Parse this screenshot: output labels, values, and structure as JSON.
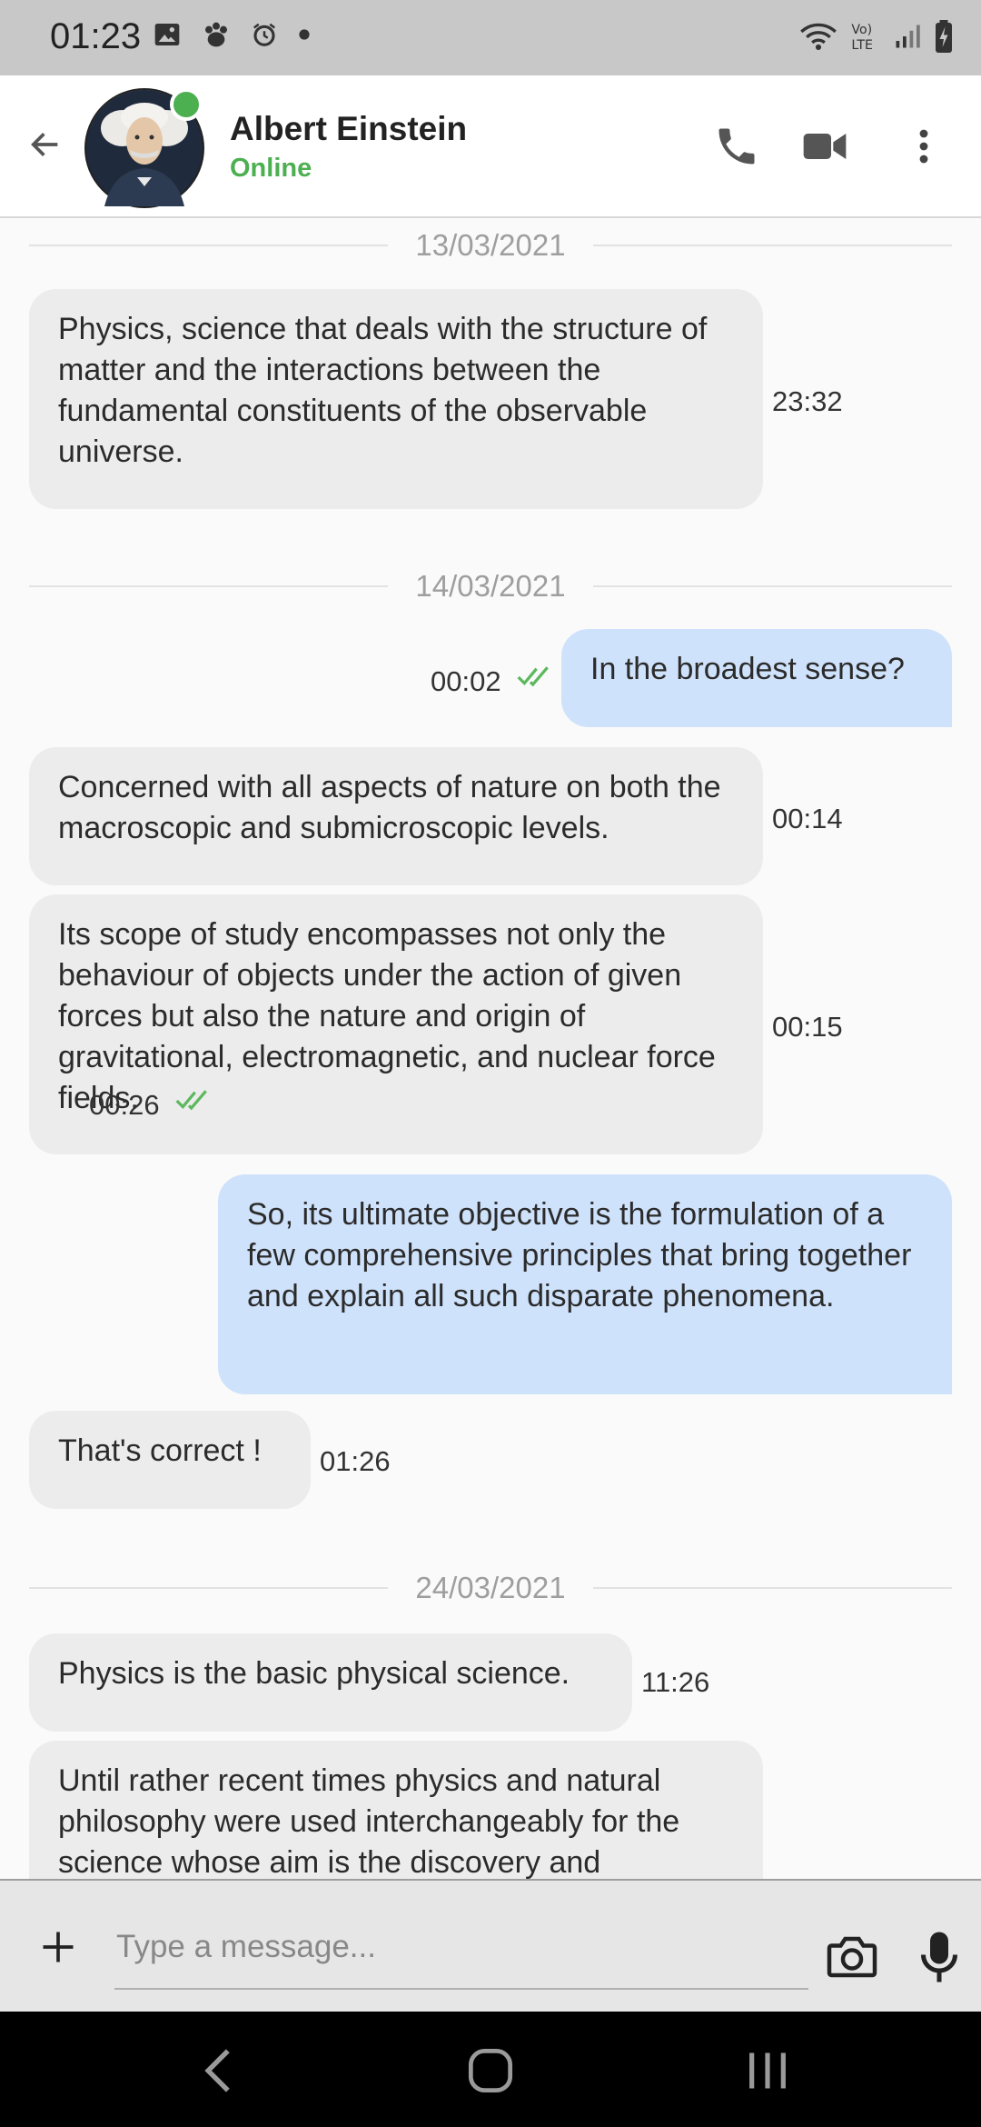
{
  "status_bar": {
    "time": "01:23",
    "icons_left": [
      "image-icon",
      "paw-icon",
      "alarm-icon",
      "dot-icon"
    ],
    "icons_right": [
      "wifi-icon",
      "volte-icon",
      "signal-icon",
      "battery-charging-icon"
    ],
    "volte_text": "Vo)\nLTE"
  },
  "header": {
    "contact_name": "Albert Einstein",
    "status": "Online",
    "actions": [
      "phone-icon",
      "video-icon",
      "more-vert-icon"
    ]
  },
  "messages": {
    "d1": {
      "date": "13/03/2021"
    },
    "m1": {
      "text": "Physics, science that deals with the structure of matter and the interactions between the fundamental constituents of the observable universe.",
      "time": "23:32",
      "direction": "incoming"
    },
    "d2": {
      "date": "14/03/2021"
    },
    "m2": {
      "text": "In the broadest sense?",
      "time": "00:02",
      "direction": "outgoing",
      "read": true
    },
    "m3": {
      "text": "Concerned with all aspects of nature on both the macroscopic and submicroscopic levels.",
      "time": "00:14",
      "direction": "incoming"
    },
    "m4": {
      "text": "Its scope of study encompasses not only the behaviour of objects under the action of given forces but also the nature and origin of gravitational, electromagnetic, and nuclear force fields.",
      "time": "00:15",
      "direction": "incoming"
    },
    "m5": {
      "text": "So, its ultimate objective is the formulation of a few comprehensive principles that bring together and explain all such disparate phenomena.",
      "time": "00:26",
      "direction": "outgoing",
      "read": true
    },
    "m6": {
      "text": "That's correct !",
      "time": "01:26",
      "direction": "incoming"
    },
    "d3": {
      "date": "24/03/2021"
    },
    "m7": {
      "text": "Physics is the basic physical science.",
      "time": "11:26",
      "direction": "incoming"
    },
    "m8": {
      "text": "Until rather recent times physics and natural philosophy were used interchangeably for the science whose aim is the discovery and",
      "direction": "incoming"
    }
  },
  "composer": {
    "placeholder": "Type a message...",
    "icons": [
      "plus-icon",
      "camera-icon",
      "mic-icon"
    ]
  },
  "nav_bar": {
    "buttons": [
      "back-nav-icon",
      "home-nav-icon",
      "recents-nav-icon"
    ]
  },
  "colors": {
    "accent_online": "#4caf50",
    "incoming_bubble": "#ececec",
    "outgoing_bubble": "#cfe2fb",
    "read_check": "#5cb85c"
  }
}
